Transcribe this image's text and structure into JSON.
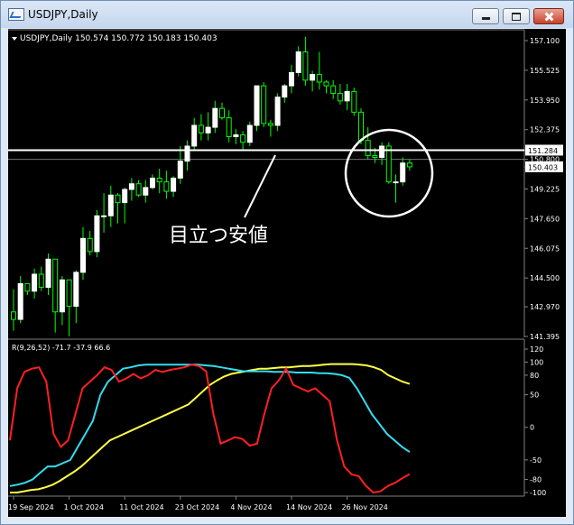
{
  "window": {
    "title": "USDJPY,Daily"
  },
  "main_chart": {
    "header": "USDJPY,Daily  150.574 150.772 150.183 150.403",
    "price_labels": [
      "157.100",
      "155.525",
      "153.950",
      "152.375",
      "151.284",
      "150.800",
      "150.403",
      "149.225",
      "147.650",
      "146.075",
      "144.500",
      "142.970",
      "141.395"
    ],
    "annotation": "目立つ安値",
    "colors": {
      "bull": "#ffffff",
      "bear": "#00ff00",
      "hline": "#ffffff",
      "price_box": "#ffffff"
    }
  },
  "indicator": {
    "header": "R(9,26,52) -71.7 -37.9 66.6",
    "scale_labels": [
      "120",
      "100",
      "80",
      "50",
      "0",
      "-50",
      "-80",
      "-100"
    ],
    "colors": {
      "fast": "#ff2020",
      "mid": "#33ddee",
      "slow": "#ffff44"
    }
  },
  "dates": [
    "19 Sep 2024",
    "1 Oct 2024",
    "11 Oct 2024",
    "23 Oct 2024",
    "4 Nov 2024",
    "14 Nov 2024",
    "26 Nov 2024"
  ],
  "chart_data": {
    "type": "candlestick",
    "candles": [
      [
        142.7,
        143.9,
        141.7,
        142.3
      ],
      [
        142.3,
        144.6,
        142.1,
        144.2
      ],
      [
        144.2,
        144.1,
        143.6,
        143.8
      ],
      [
        143.8,
        145.0,
        143.4,
        144.7
      ],
      [
        144.7,
        145.1,
        143.8,
        144.0
      ],
      [
        144.0,
        145.8,
        143.6,
        145.5
      ],
      [
        145.5,
        145.2,
        141.6,
        142.7
      ],
      [
        142.7,
        144.6,
        142.0,
        144.4
      ],
      [
        144.4,
        144.0,
        141.4,
        143.0
      ],
      [
        143.0,
        144.9,
        142.1,
        144.8
      ],
      [
        144.8,
        147.2,
        144.4,
        146.6
      ],
      [
        146.6,
        147.0,
        145.7,
        145.9
      ],
      [
        145.9,
        148.1,
        145.6,
        147.8
      ],
      [
        147.8,
        149.0,
        146.9,
        147.8
      ],
      [
        147.8,
        149.4,
        147.2,
        148.9
      ],
      [
        148.9,
        149.0,
        147.4,
        148.5
      ],
      [
        148.5,
        149.3,
        147.4,
        149.2
      ],
      [
        149.2,
        149.8,
        148.6,
        149.5
      ],
      [
        149.5,
        149.7,
        148.8,
        148.9
      ],
      [
        148.9,
        149.7,
        148.5,
        149.3
      ],
      [
        149.3,
        150.0,
        149.2,
        149.8
      ],
      [
        149.8,
        150.3,
        149.0,
        149.6
      ],
      [
        149.6,
        150.2,
        148.7,
        149.1
      ],
      [
        149.1,
        149.9,
        148.8,
        149.8
      ],
      [
        149.8,
        151.5,
        149.5,
        150.7
      ],
      [
        150.7,
        151.8,
        150.2,
        151.5
      ],
      [
        151.5,
        153.0,
        151.3,
        152.6
      ],
      [
        152.6,
        153.2,
        151.8,
        152.2
      ],
      [
        152.2,
        153.3,
        151.8,
        152.5
      ],
      [
        152.5,
        153.9,
        152.2,
        153.5
      ],
      [
        153.5,
        153.8,
        152.9,
        153.0
      ],
      [
        153.0,
        153.4,
        151.7,
        152.0
      ],
      [
        152.0,
        152.4,
        151.6,
        152.1
      ],
      [
        152.1,
        152.3,
        151.3,
        151.7
      ],
      [
        151.7,
        152.8,
        151.5,
        152.6
      ],
      [
        152.6,
        154.6,
        152.3,
        154.7
      ],
      [
        154.7,
        154.9,
        152.5,
        152.7
      ],
      [
        152.7,
        152.9,
        152.0,
        152.6
      ],
      [
        152.6,
        154.3,
        152.3,
        154.1
      ],
      [
        154.1,
        154.8,
        153.8,
        154.7
      ],
      [
        154.7,
        155.8,
        154.3,
        155.4
      ],
      [
        155.4,
        156.8,
        155.2,
        156.5
      ],
      [
        156.5,
        157.3,
        154.7,
        155.0
      ],
      [
        155.0,
        155.5,
        154.4,
        155.3
      ],
      [
        155.3,
        156.5,
        154.5,
        154.9
      ],
      [
        154.9,
        155.0,
        154.3,
        154.7
      ],
      [
        154.7,
        155.0,
        154.0,
        154.3
      ],
      [
        154.3,
        154.8,
        153.7,
        153.9
      ],
      [
        153.9,
        154.8,
        153.4,
        154.4
      ],
      [
        154.4,
        154.6,
        153.1,
        153.3
      ],
      [
        153.3,
        153.5,
        151.6,
        151.8
      ],
      [
        151.8,
        152.5,
        150.8,
        151.0
      ],
      [
        151.0,
        151.4,
        150.6,
        150.9
      ],
      [
        150.9,
        151.7,
        150.5,
        151.5
      ],
      [
        151.5,
        151.7,
        149.5,
        149.6
      ],
      [
        149.6,
        150.0,
        148.5,
        149.6
      ],
      [
        149.6,
        150.9,
        149.4,
        150.6
      ],
      [
        150.6,
        150.8,
        150.2,
        150.4
      ]
    ],
    "horizontal_line": 151.284,
    "current_price": 150.403,
    "indicator_series": [
      {
        "name": "R(9)",
        "values": [
          -20,
          60,
          85,
          90,
          92,
          70,
          -10,
          -30,
          -20,
          20,
          60,
          70,
          80,
          92,
          88,
          70,
          75,
          82,
          75,
          80,
          88,
          85,
          88,
          90,
          92,
          96,
          94,
          86,
          20,
          -25,
          -20,
          -15,
          -18,
          -28,
          -25,
          20,
          60,
          72,
          90,
          65,
          60,
          55,
          60,
          50,
          40,
          -20,
          -60,
          -72,
          -75,
          -90,
          -100,
          -98,
          -90,
          -85,
          -78,
          -71.7
        ]
      },
      {
        "name": "R(26)",
        "values": [
          -90,
          -88,
          -85,
          -80,
          -70,
          -60,
          -60,
          -55,
          -50,
          -30,
          -10,
          10,
          50,
          70,
          80,
          90,
          92,
          95,
          96,
          96,
          96,
          96,
          96,
          96,
          96,
          96,
          95,
          94,
          92,
          90,
          88,
          86,
          86,
          86,
          86,
          85,
          85,
          85,
          84,
          84,
          84,
          83,
          83,
          82,
          80,
          76,
          60,
          40,
          20,
          5,
          -10,
          -20,
          -30,
          -37.9
        ]
      },
      {
        "name": "R(52)",
        "values": [
          -100,
          -100,
          -98,
          -96,
          -95,
          -92,
          -88,
          -82,
          -75,
          -68,
          -60,
          -50,
          -40,
          -30,
          -20,
          -15,
          -10,
          -5,
          0,
          5,
          10,
          15,
          20,
          25,
          30,
          35,
          45,
          55,
          65,
          72,
          78,
          82,
          84,
          86,
          88,
          90,
          90,
          91,
          92,
          92,
          93,
          94,
          94,
          95,
          96,
          97,
          97,
          97,
          97,
          96,
          95,
          92,
          88,
          80,
          75,
          70,
          66.6
        ]
      }
    ]
  }
}
